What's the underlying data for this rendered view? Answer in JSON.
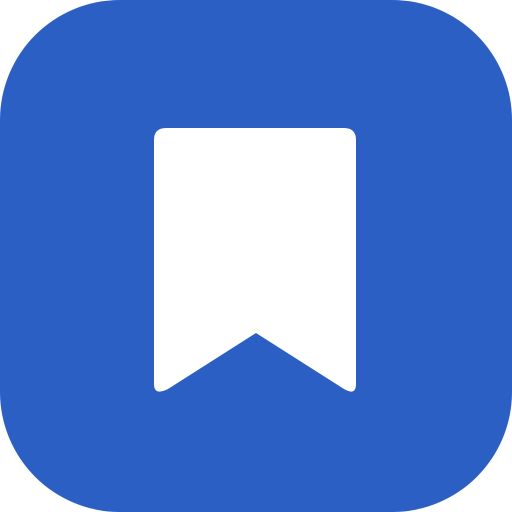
{
  "app_icon": {
    "name": "bookmark-icon",
    "background_color": "#2C5FC3",
    "glyph_color": "#FFFFFF"
  }
}
